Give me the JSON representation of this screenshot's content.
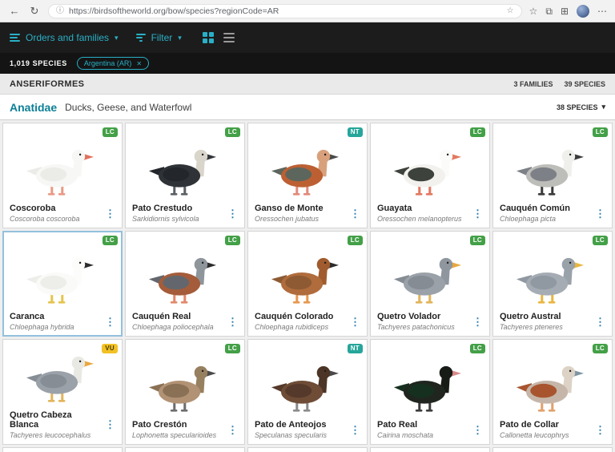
{
  "browser": {
    "url": "https://birdsoftheworld.org/bow/species?regionCode=AR"
  },
  "toolbar": {
    "orders_label": "Orders and families",
    "filter_label": "Filter"
  },
  "results_bar": {
    "count_label": "1,019 SPECIES",
    "region_chip_label": "Argentina (AR)"
  },
  "order_header": {
    "name": "ANSERIFORMES",
    "families_count": "3 FAMILIES",
    "species_count": "39 SPECIES"
  },
  "family_header": {
    "name": "Anatidae",
    "description": "Ducks, Geese, and Waterfowl",
    "count": "38 SPECIES"
  },
  "badge_colors": {
    "LC": {
      "bg": "#43a047",
      "fg": "#ffffff"
    },
    "NT": {
      "bg": "#26a69a",
      "fg": "#ffffff"
    },
    "VU": {
      "bg": "#f2c124",
      "fg": "#4a3b00"
    }
  },
  "species": [
    {
      "name": "Coscoroba",
      "sci": "Coscoroba coscoroba",
      "status": "LC",
      "colors": {
        "body": "#f7f7f5",
        "wing": "#ebebe7",
        "head": "#f7f7f5",
        "bill": "#e2705c",
        "legs": "#e89a86"
      }
    },
    {
      "name": "Pato Crestudo",
      "sci": "Sarkidiornis sylvicola",
      "status": "LC",
      "colors": {
        "body": "#2f3338",
        "wing": "#23272c",
        "head": "#d9d5cb",
        "bill": "#33363a",
        "legs": "#5b6066"
      }
    },
    {
      "name": "Ganso de Monte",
      "sci": "Oressochen jubatus",
      "status": "NT",
      "colors": {
        "body": "#bc6033",
        "wing": "#5d665c",
        "head": "#d8a17c",
        "bill": "#4a4a4a",
        "legs": "#e2897b"
      }
    },
    {
      "name": "Guayata",
      "sci": "Oressochen melanopterus",
      "status": "LC",
      "colors": {
        "body": "#f2f1ee",
        "wing": "#3d423d",
        "head": "#fbfbf9",
        "bill": "#e2795f",
        "legs": "#e2795f"
      }
    },
    {
      "name": "Cauquén Común",
      "sci": "Chloephaga picta",
      "status": "LC",
      "colors": {
        "body": "#bdbdba",
        "wing": "#7d8187",
        "head": "#efefec",
        "bill": "#3a3a3a",
        "legs": "#3a3a3a"
      }
    },
    {
      "name": "Caranca",
      "sci": "Chloephaga hybrida",
      "status": "LC",
      "selected": true,
      "colors": {
        "body": "#fafaf8",
        "wing": "#ededea",
        "head": "#fcfcfa",
        "bill": "#2b2b2b",
        "legs": "#e5c44e"
      }
    },
    {
      "name": "Cauquén Real",
      "sci": "Chloephaga poliocephala",
      "status": "LC",
      "colors": {
        "body": "#a55c3a",
        "wing": "#63676d",
        "head": "#8e959b",
        "bill": "#2b2b2b",
        "legs": "#e2896b"
      }
    },
    {
      "name": "Cauquén Colorado",
      "sci": "Chloephaga rubidiceps",
      "status": "LC",
      "colors": {
        "body": "#b06c3c",
        "wing": "#8d5a33",
        "head": "#a05c2e",
        "bill": "#2b2b2b",
        "legs": "#e8984f"
      }
    },
    {
      "name": "Quetro Volador",
      "sci": "Tachyeres patachonicus",
      "status": "LC",
      "colors": {
        "body": "#9aa1a8",
        "wing": "#858c94",
        "head": "#8f969e",
        "bill": "#e9a83f",
        "legs": "#e2b45a"
      }
    },
    {
      "name": "Quetro Austral",
      "sci": "Tachyeres pteneres",
      "status": "LC",
      "colors": {
        "body": "#a6acb4",
        "wing": "#9098a1",
        "head": "#99a1a9",
        "bill": "#e9b63f",
        "legs": "#e9b63f"
      }
    },
    {
      "name": "Quetro Cabeza Blanca",
      "sci": "Tachyeres leucocephalus",
      "status": "VU",
      "colors": {
        "body": "#9aa1a8",
        "wing": "#868d95",
        "head": "#e9e9e4",
        "bill": "#e9a83f",
        "legs": "#e2b45a"
      }
    },
    {
      "name": "Pato Crestón",
      "sci": "Lophonetta specularioides",
      "status": "LC",
      "colors": {
        "body": "#b29274",
        "wing": "#8a7156",
        "head": "#97805f",
        "bill": "#4a4a4a",
        "legs": "#6d6d6d"
      }
    },
    {
      "name": "Pato de Anteojos",
      "sci": "Speculanas specularis",
      "status": "NT",
      "colors": {
        "body": "#6e4c36",
        "wing": "#55392a",
        "head": "#4c3526",
        "bill": "#4a4a4a",
        "legs": "#8a8a8a"
      }
    },
    {
      "name": "Pato Real",
      "sci": "Cairina moschata",
      "status": "LC",
      "colors": {
        "body": "#20261f",
        "wing": "#15301f",
        "head": "#171c17",
        "bill": "#d98a8a",
        "legs": "#3c3c3c"
      }
    },
    {
      "name": "Pato de Collar",
      "sci": "Callonetta leucophrys",
      "status": "LC",
      "colors": {
        "body": "#c6b6a9",
        "wing": "#a8552f",
        "head": "#dcd2c6",
        "bill": "#7e95a3",
        "legs": "#e2a06a"
      }
    }
  ]
}
